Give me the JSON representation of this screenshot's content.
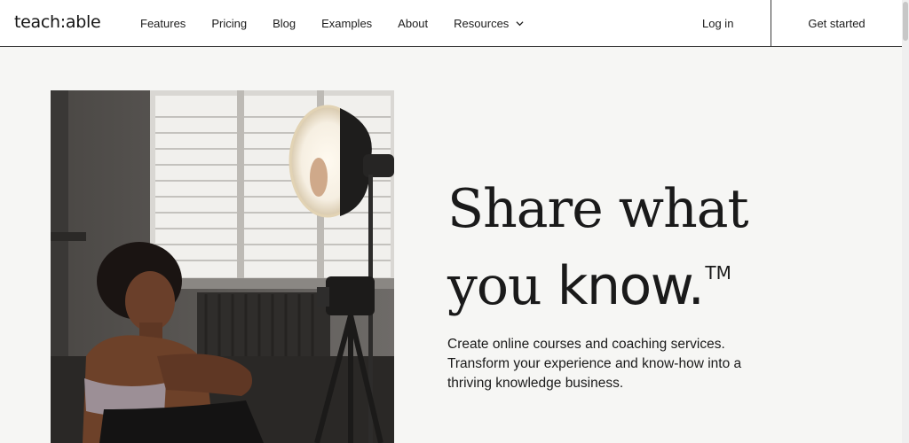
{
  "header": {
    "logo": "teach:able",
    "nav": [
      {
        "label": "Features"
      },
      {
        "label": "Pricing"
      },
      {
        "label": "Blog"
      },
      {
        "label": "Examples"
      },
      {
        "label": "About"
      },
      {
        "label": "Resources",
        "has_dropdown": true
      }
    ],
    "login_label": "Log in",
    "cta_label": "Get started"
  },
  "hero": {
    "headline_line1": "Share what",
    "headline_line2_regular": "you ",
    "headline_line2_bold": "know.",
    "trademark": "TM",
    "subtext_lines": [
      "Create online courses and coaching services.",
      "Transform your experience and know-how into a",
      "thriving knowledge business."
    ],
    "image_icon": "hero-photo-creator-with-camera"
  }
}
